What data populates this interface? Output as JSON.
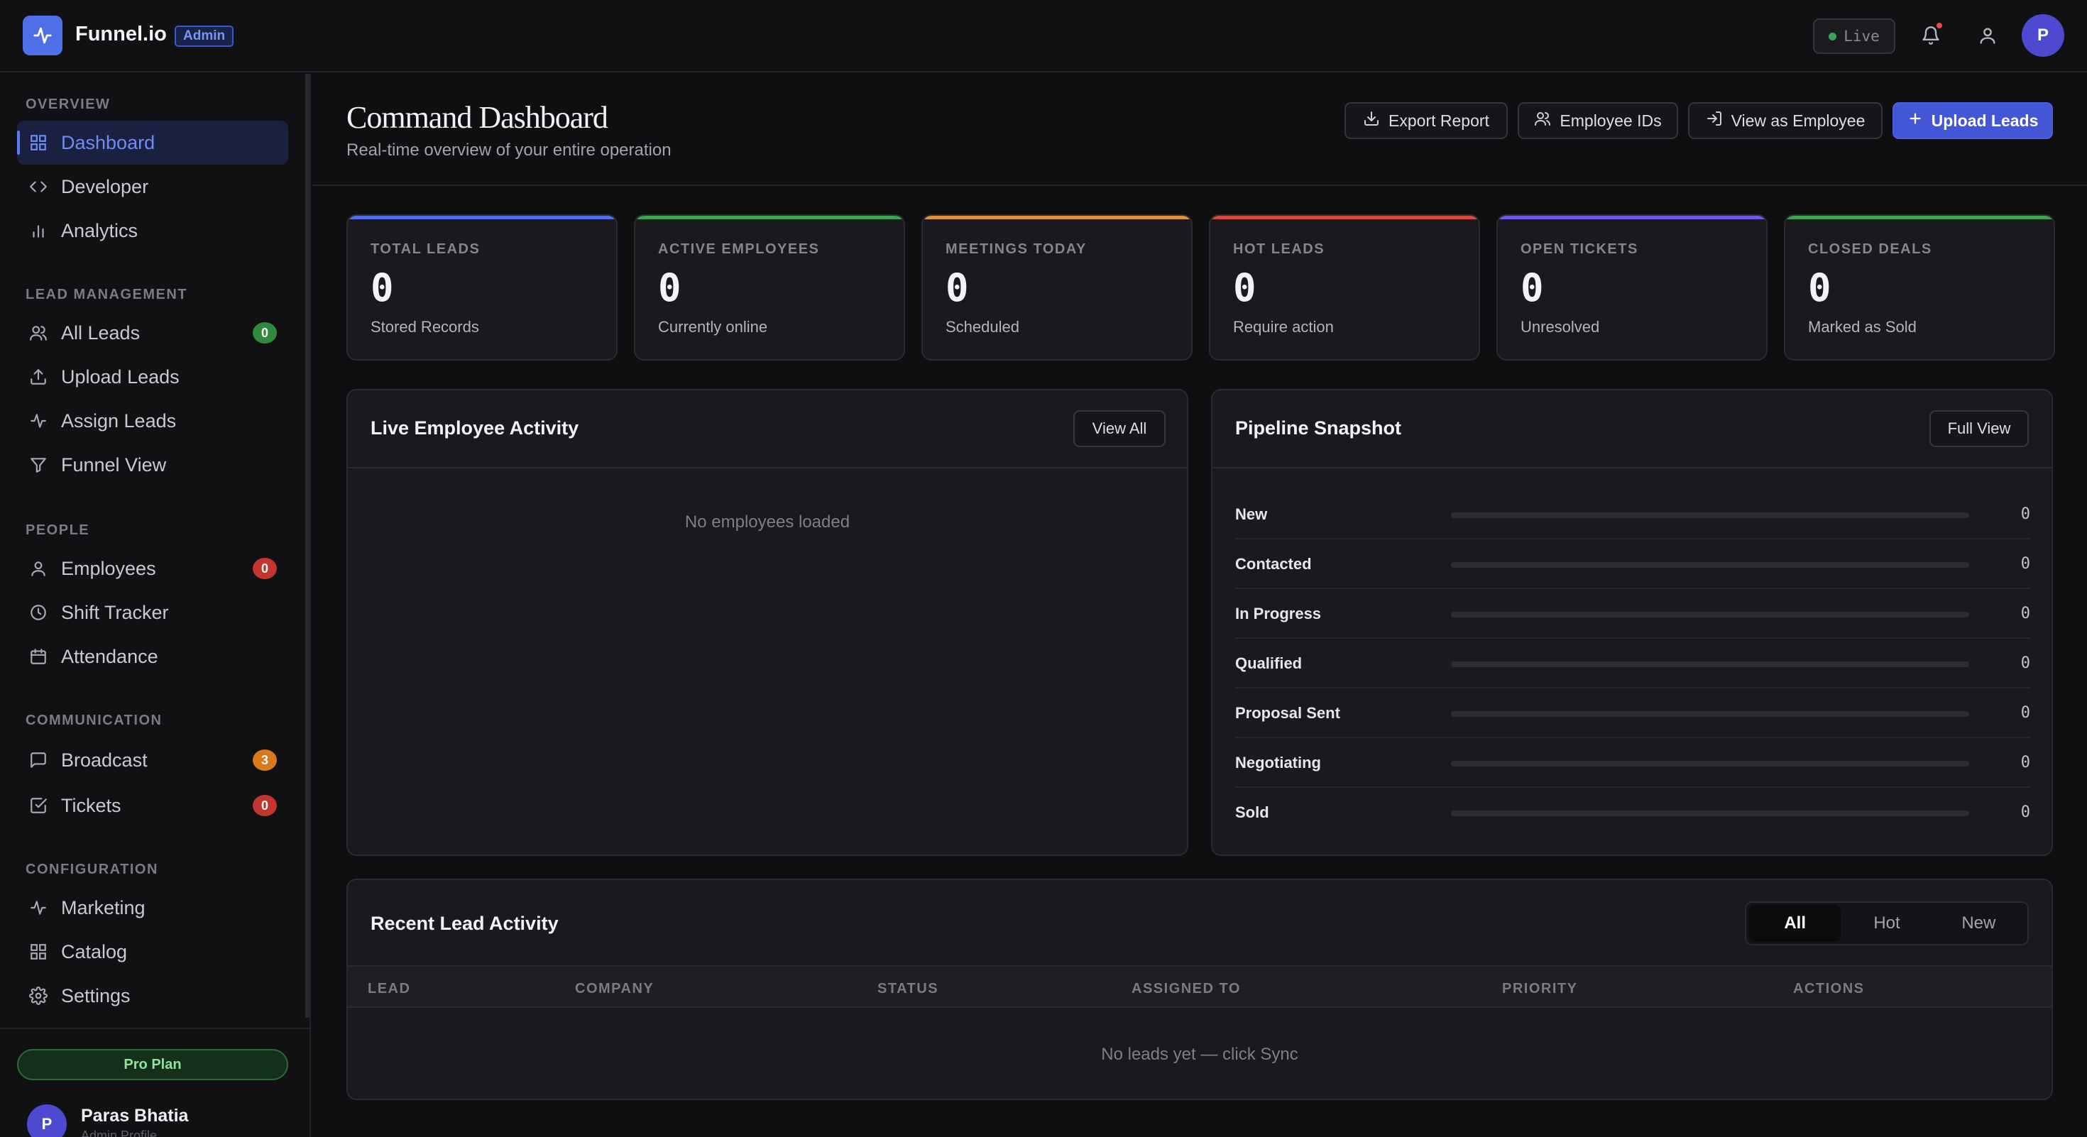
{
  "app": {
    "brand": "Funnel.io",
    "role_badge": "Admin",
    "live_label": "Live",
    "avatar_initial": "P"
  },
  "sidebar": {
    "sections": [
      {
        "title": "OVERVIEW",
        "items": [
          {
            "label": "Dashboard",
            "icon": "grid-icon",
            "active": true
          },
          {
            "label": "Developer",
            "icon": "code-icon"
          },
          {
            "label": "Analytics",
            "icon": "bar-chart-icon"
          }
        ]
      },
      {
        "title": "LEAD MANAGEMENT",
        "items": [
          {
            "label": "All Leads",
            "icon": "users-icon",
            "badge": "0",
            "badge_color": "#2f8a3e"
          },
          {
            "label": "Upload Leads",
            "icon": "upload-icon"
          },
          {
            "label": "Assign Leads",
            "icon": "activity-icon"
          },
          {
            "label": "Funnel View",
            "icon": "filter-icon"
          }
        ]
      },
      {
        "title": "PEOPLE",
        "items": [
          {
            "label": "Employees",
            "icon": "user-icon",
            "badge": "0",
            "badge_color": "#c2362f"
          },
          {
            "label": "Shift Tracker",
            "icon": "clock-icon"
          },
          {
            "label": "Attendance",
            "icon": "calendar-icon"
          }
        ]
      },
      {
        "title": "COMMUNICATION",
        "items": [
          {
            "label": "Broadcast",
            "icon": "message-icon",
            "badge": "3",
            "badge_color": "#d97a1a"
          },
          {
            "label": "Tickets",
            "icon": "check-square-icon",
            "badge": "0",
            "badge_color": "#c2362f"
          }
        ]
      },
      {
        "title": "CONFIGURATION",
        "items": [
          {
            "label": "Marketing",
            "icon": "activity-icon"
          },
          {
            "label": "Catalog",
            "icon": "grid-icon"
          },
          {
            "label": "Settings",
            "icon": "gear-icon"
          }
        ]
      }
    ],
    "plan_label": "Pro Plan",
    "user": {
      "initial": "P",
      "name": "Paras Bhatia",
      "role": "Admin Profile"
    }
  },
  "header": {
    "title": "Command Dashboard",
    "subtitle": "Real-time overview of your entire operation",
    "buttons": {
      "export": "Export Report",
      "employee_ids": "Employee IDs",
      "view_as": "View as Employee",
      "upload": "Upload Leads"
    }
  },
  "stats": [
    {
      "label": "TOTAL LEADS",
      "value": "0",
      "sub": "Stored Records",
      "color": "#4f6fe8"
    },
    {
      "label": "ACTIVE EMPLOYEES",
      "value": "0",
      "sub": "Currently online",
      "color": "#3aa356"
    },
    {
      "label": "MEETINGS TODAY",
      "value": "0",
      "sub": "Scheduled",
      "color": "#e0913a"
    },
    {
      "label": "HOT LEADS",
      "value": "0",
      "sub": "Require action",
      "color": "#d9483f"
    },
    {
      "label": "OPEN TICKETS",
      "value": "0",
      "sub": "Unresolved",
      "color": "#6b5ae6"
    },
    {
      "label": "CLOSED DEALS",
      "value": "0",
      "sub": "Marked as Sold",
      "color": "#3aa356"
    }
  ],
  "activity": {
    "title": "Live Employee Activity",
    "button": "View All",
    "empty": "No employees loaded"
  },
  "pipeline": {
    "title": "Pipeline Snapshot",
    "button": "Full View",
    "stages": [
      {
        "label": "New",
        "count": 0,
        "fill": 0
      },
      {
        "label": "Contacted",
        "count": 0,
        "fill": 0
      },
      {
        "label": "In Progress",
        "count": 0,
        "fill": 0
      },
      {
        "label": "Qualified",
        "count": 0,
        "fill": 0
      },
      {
        "label": "Proposal Sent",
        "count": 0,
        "fill": 0
      },
      {
        "label": "Negotiating",
        "count": 0,
        "fill": 0
      },
      {
        "label": "Sold",
        "count": 0,
        "fill": 0
      }
    ]
  },
  "recent": {
    "title": "Recent Lead Activity",
    "filters": [
      "All",
      "Hot",
      "New"
    ],
    "active_filter": "All",
    "columns": [
      "LEAD",
      "COMPANY",
      "STATUS",
      "ASSIGNED TO",
      "PRIORITY",
      "ACTIONS"
    ],
    "empty": "No leads yet — click Sync"
  }
}
